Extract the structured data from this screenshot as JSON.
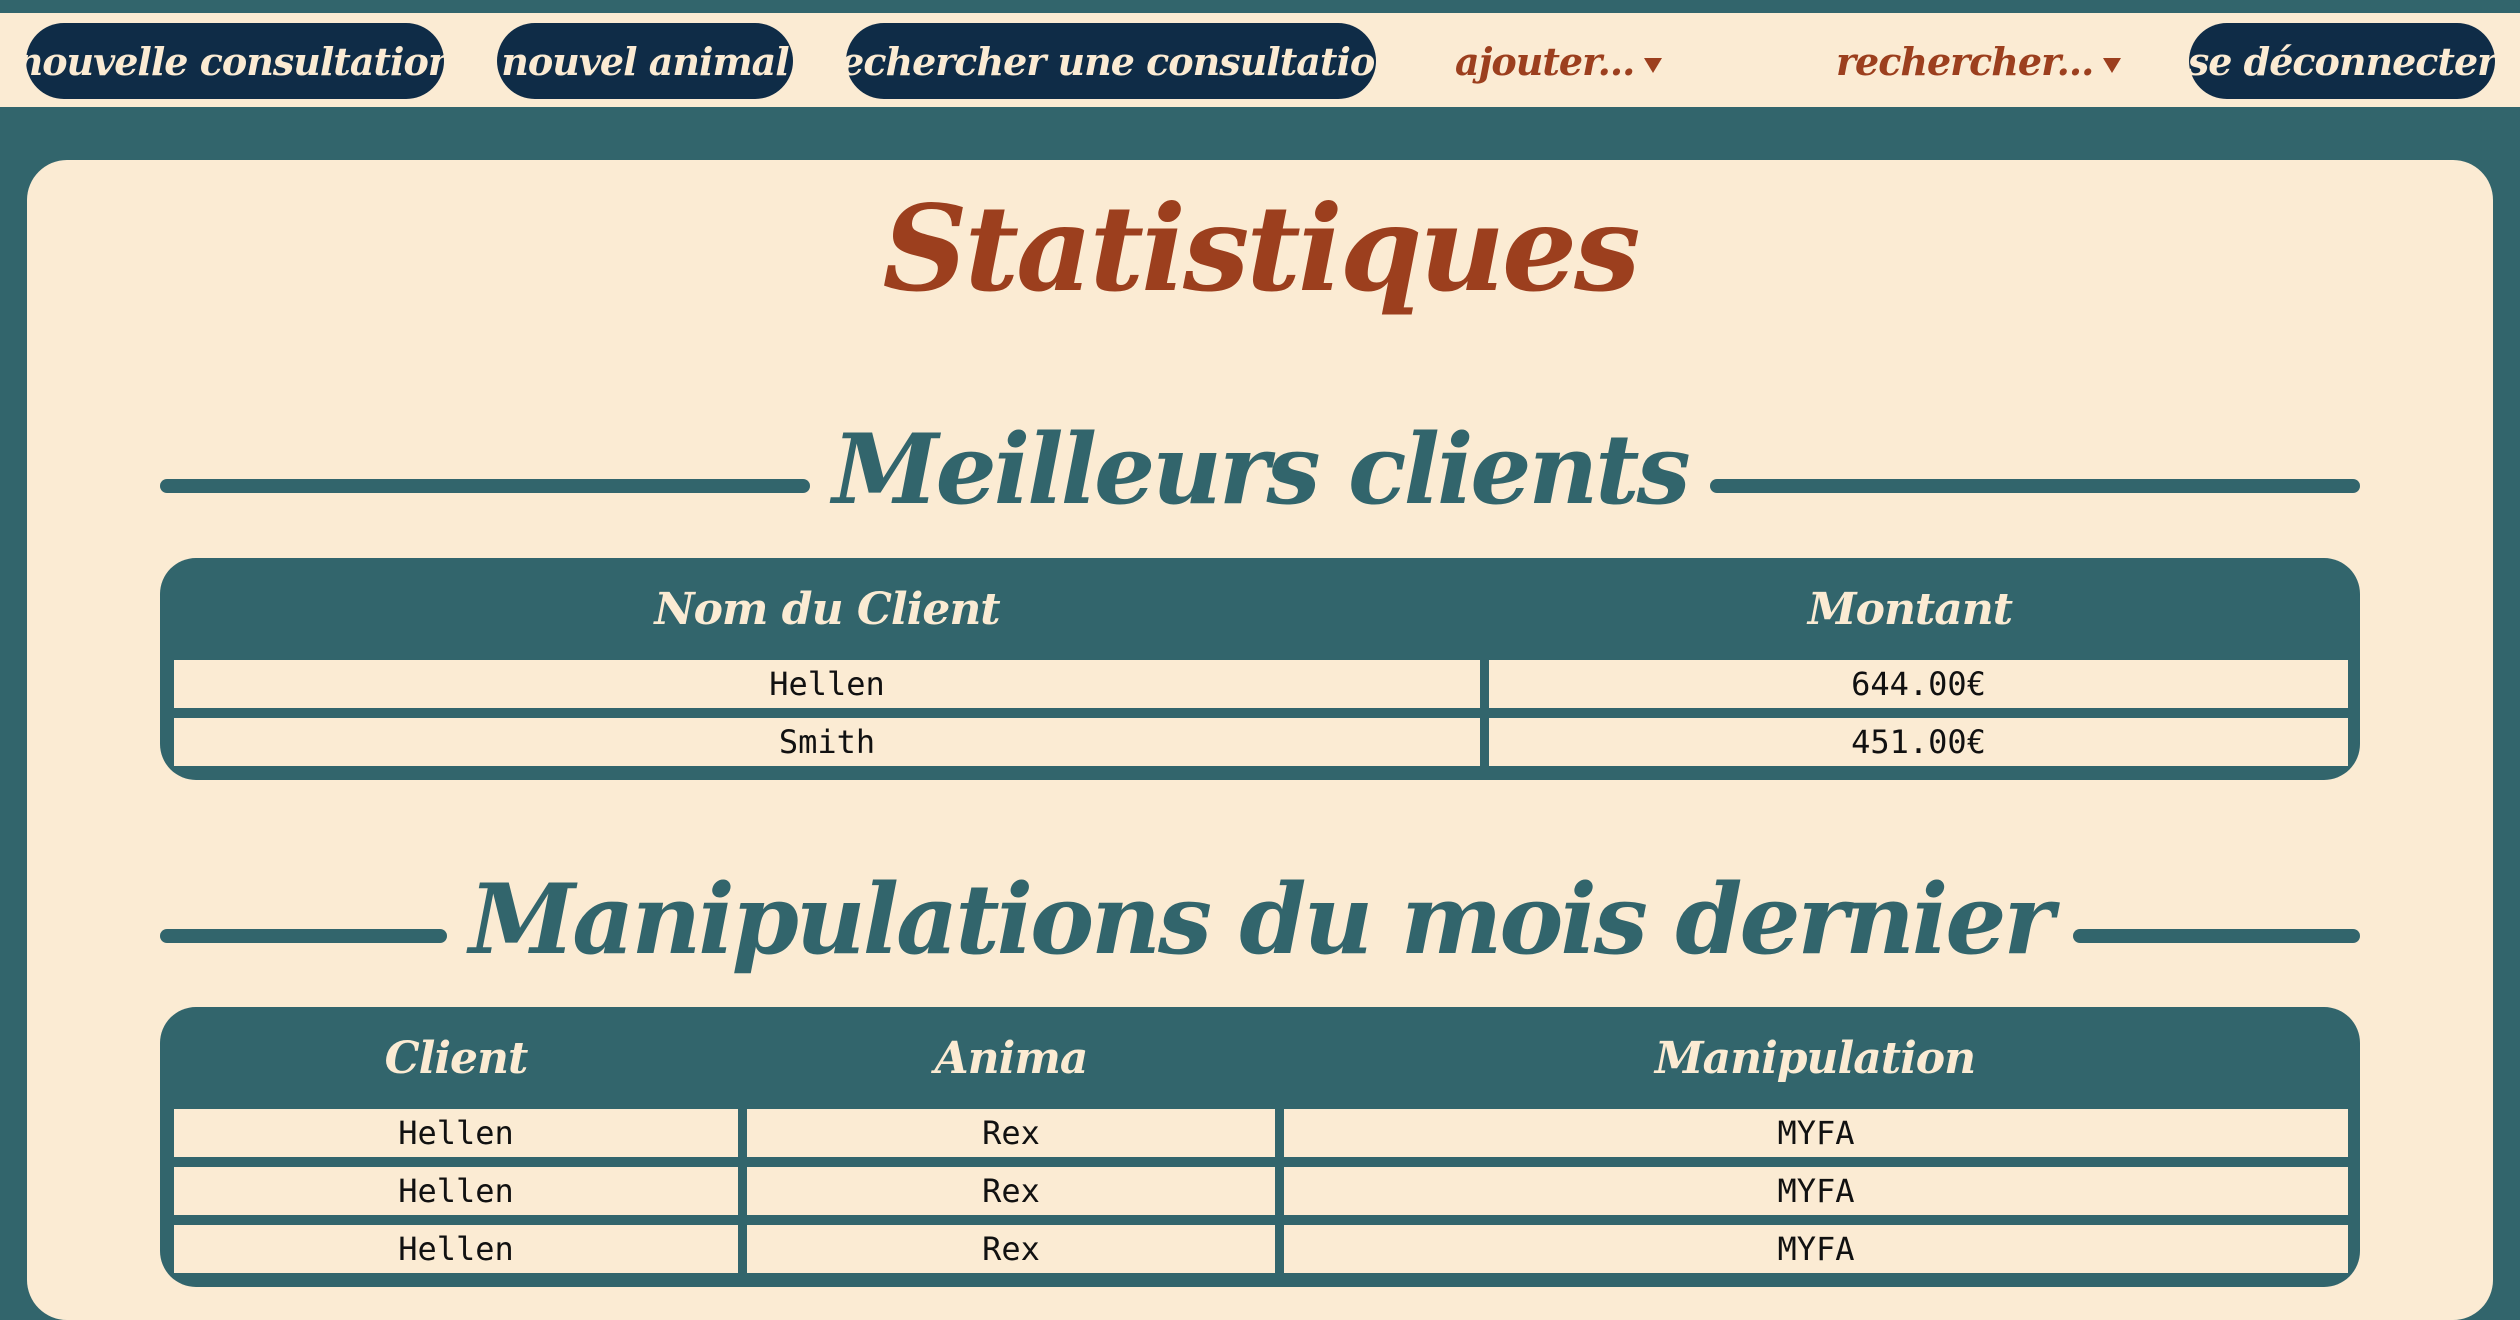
{
  "nav": {
    "new_consultation": "nouvelle consultation",
    "new_animal": "nouvel animal",
    "search_consultation": "rechercher une consultation",
    "add_menu": "ajouter...",
    "search_menu": "rechercher...",
    "logout": "se déconnecter"
  },
  "page": {
    "title": "Statistiques"
  },
  "best_clients": {
    "title": "Meilleurs clients",
    "headers": [
      "Nom du Client",
      "Montant"
    ],
    "rows": [
      [
        "Hellen",
        "644.00€"
      ],
      [
        "Smith",
        "451.00€"
      ]
    ]
  },
  "manipulations": {
    "title": "Manipulations du mois dernier",
    "headers": [
      "Client",
      "Anima",
      "Manipulation"
    ],
    "rows": [
      [
        "Hellen",
        "Rex",
        "MYFA"
      ],
      [
        "Hellen",
        "Rex",
        "MYFA"
      ],
      [
        "Hellen",
        "Rex",
        "MYFA"
      ]
    ]
  },
  "colors": {
    "background": "#32656c",
    "cream": "#fbebd3",
    "navy_button": "#0f2c47",
    "accent_rust": "#9c3f1e"
  }
}
